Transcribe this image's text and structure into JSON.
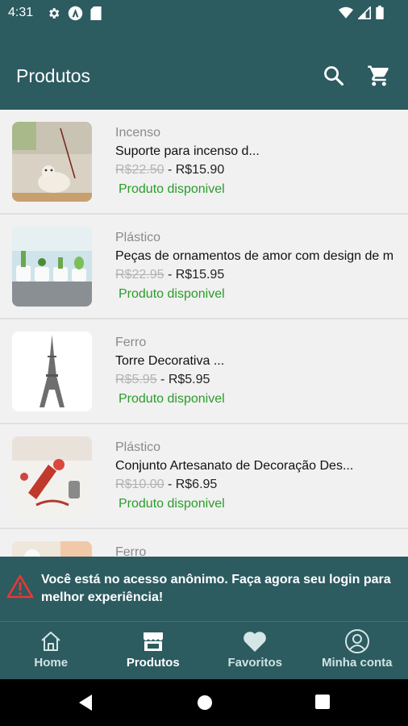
{
  "status_bar": {
    "time": "4:31"
  },
  "app_bar": {
    "title": "Produtos"
  },
  "products": [
    {
      "category": "Incenso",
      "name": "Suporte para incenso d...",
      "old_price": "R$22.50",
      "separator": " - ",
      "price": "R$15.90",
      "stock": "Produto disponivel"
    },
    {
      "category": "Plástico",
      "name": "Peças de ornamentos de amor com design de m",
      "old_price": "R$22.95",
      "separator": " - ",
      "price": "R$15.95",
      "stock": "Produto disponivel"
    },
    {
      "category": "Ferro",
      "name": "Torre Decorativa ...",
      "old_price": "R$5.95",
      "separator": " - ",
      "price": "R$5.95",
      "stock": "Produto disponivel"
    },
    {
      "category": "Plástico",
      "name": "Conjunto Artesanato de Decoração Des...",
      "old_price": "R$10.00",
      "separator": " - ",
      "price": "R$6.95",
      "stock": "Produto disponivel"
    },
    {
      "category": "Ferro"
    }
  ],
  "banner": {
    "message": "Você está no acesso anônimo. Faça agora seu login para melhor experiência!"
  },
  "bottom_nav": [
    {
      "label": "Home",
      "icon": "home-icon"
    },
    {
      "label": "Produtos",
      "icon": "store-icon"
    },
    {
      "label": "Favoritos",
      "icon": "heart-icon"
    },
    {
      "label": "Minha conta",
      "icon": "account-icon"
    }
  ],
  "colors": {
    "primary": "#2c5b60",
    "stock": "#2a9c2a",
    "warning": "#e53935"
  }
}
